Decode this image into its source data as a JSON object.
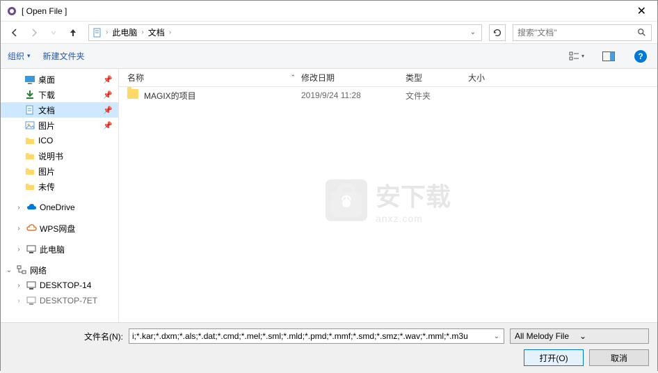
{
  "title": "[ Open File ]",
  "breadcrumb": {
    "seg1": "此电脑",
    "seg2": "文档"
  },
  "search": {
    "placeholder": "搜索\"文档\""
  },
  "toolbar": {
    "organize": "组织",
    "newfolder": "新建文件夹"
  },
  "columns": {
    "name": "名称",
    "date": "修改日期",
    "type": "类型",
    "size": "大小"
  },
  "sidebar": {
    "items": [
      {
        "label": "桌面",
        "icon": "desktop",
        "pinned": true
      },
      {
        "label": "下载",
        "icon": "download",
        "pinned": true
      },
      {
        "label": "文档",
        "icon": "document",
        "pinned": true,
        "selected": true
      },
      {
        "label": "图片",
        "icon": "picture",
        "pinned": true
      },
      {
        "label": "ICO",
        "icon": "folder"
      },
      {
        "label": "说明书",
        "icon": "folder"
      },
      {
        "label": "图片",
        "icon": "folder"
      },
      {
        "label": "未传",
        "icon": "folder"
      }
    ],
    "onedrive": "OneDrive",
    "wps": "WPS网盘",
    "thispc": "此电脑",
    "network": "网络",
    "net_items": [
      "DESKTOP-14",
      "DESKTOP-7ET"
    ]
  },
  "files": [
    {
      "name": "MAGIX的项目",
      "date": "2019/9/24 11:28",
      "type": "文件夹",
      "size": ""
    }
  ],
  "watermark": {
    "big": "安下载",
    "small": "anxz.com"
  },
  "bottom": {
    "filename_label": "文件名(N):",
    "filename_value": "i;*.kar;*.dxm;*.als;*.dat;*.cmd;*.mel;*.sml;*.mld;*.pmd;*.mmf;*.smd;*.smz;*.wav;*.mml;*.m3u",
    "filter_label": "All Melody File",
    "open": "打开(O)",
    "cancel": "取消"
  }
}
